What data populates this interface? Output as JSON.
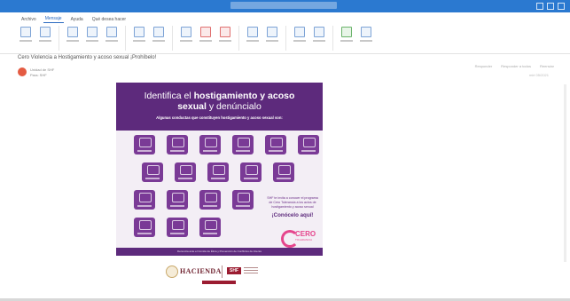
{
  "window": {
    "title": "Cero Violencia a Hostigamiento y acoso sexual ¡Prohíbelo!"
  },
  "tabs": [
    "Archivo",
    "Mensaje",
    "Ayuda",
    "Qué desea hacer"
  ],
  "subject": "Cero Violencia a Hostigamiento y acoso sexual ¡Prohíbelo!",
  "sender": {
    "line1": "Unidad de SHF",
    "line2": "Para: SHF"
  },
  "header_actions": [
    "Responder",
    "Responder a todos",
    "Reenviar"
  ],
  "date": "mié 05/2021",
  "poster": {
    "title_prefix": "Identifica el",
    "title_bold": "hostigamiento y acoso",
    "title_line2_bold": "sexual",
    "title_suffix": "y denúncialo",
    "subtitle": "Algunas conductas que constituyen hostigamiento y acoso sexual son:",
    "info_text": "SHF te invita a conocer el programa de Cero Tolerancia a los actos de hostigamiento y acoso sexual",
    "cta": "¡Conócelo aquí!",
    "brand": "CERO",
    "brand_sub": "TOLERANCIA",
    "bottom_text": "Denuncia ante el Comité de Ética y Prevención de Conflictos de Interés"
  },
  "footer": {
    "hacienda": "HACIENDA",
    "shf": "SHF"
  },
  "colors": {
    "titlebar": "#2b79d0",
    "poster_primary": "#5d2a7c",
    "tile": "#7a3a96",
    "accent": "#e5458c",
    "maroon": "#9b1c31"
  }
}
